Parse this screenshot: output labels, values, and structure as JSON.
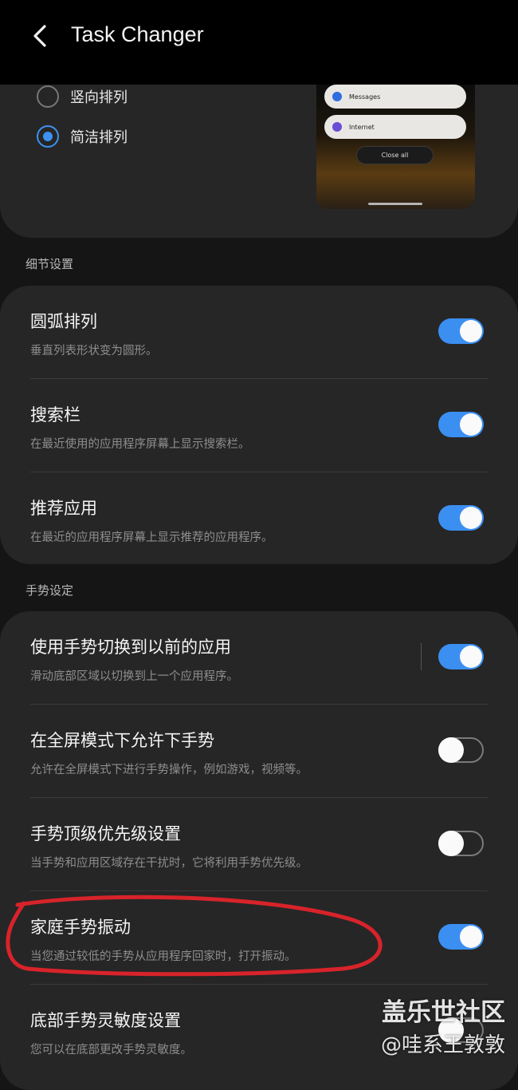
{
  "header": {
    "title": "Task Changer",
    "back_icon": "back-arrow-icon"
  },
  "layout_options": [
    {
      "label": "竖向排列",
      "selected": false
    },
    {
      "label": "简洁排列",
      "selected": true
    }
  ],
  "preview": {
    "apps": [
      {
        "name": "Messages",
        "color": "#2f6de0"
      },
      {
        "name": "Internet",
        "color": "#6a4cd6"
      }
    ],
    "close_all": "Close all"
  },
  "details_section": {
    "label": "细节设置",
    "items": [
      {
        "title": "圆弧排列",
        "subtitle": "垂直列表形状变为圆形。",
        "on": true
      },
      {
        "title": "搜索栏",
        "subtitle": "在最近使用的应用程序屏幕上显示搜索栏。",
        "on": true
      },
      {
        "title": "推荐应用",
        "subtitle": "在最近的应用程序屏幕上显示推荐的应用程序。",
        "on": true
      }
    ]
  },
  "gesture_section": {
    "label": "手势设定",
    "items": [
      {
        "title": "使用手势切换到以前的应用",
        "subtitle": "滑动底部区域以切换到上一个应用程序。",
        "on": true
      },
      {
        "title": "在全屏模式下允许下手势",
        "subtitle": "允许在全屏模式下进行手势操作，例如游戏，视频等。",
        "on": false
      },
      {
        "title": "手势顶级优先级设置",
        "subtitle": "当手势和应用区域存在干扰时，它将利用手势优先级。",
        "on": false
      },
      {
        "title": "家庭手势振动",
        "subtitle": "当您通过较低的手势从应用程序回家时，打开振动。",
        "on": true
      },
      {
        "title": "底部手势灵敏度设置",
        "subtitle": "您可以在底部更改手势灵敏度。",
        "on": false
      }
    ]
  },
  "watermark": {
    "line1": "盖乐世社区",
    "line2": "@哇系王敦敦"
  },
  "colors": {
    "accent": "#3b8ff1",
    "annotation": "#d8232a"
  }
}
